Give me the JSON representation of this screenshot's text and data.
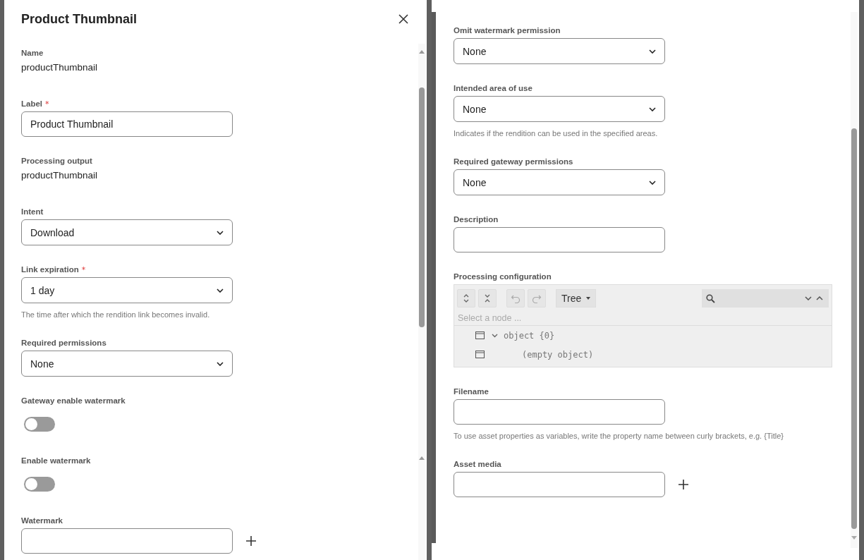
{
  "left_panel": {
    "title": "Product Thumbnail",
    "fields": [
      {
        "kind": "readonly",
        "label": "Name",
        "value": "productThumbnail"
      },
      {
        "kind": "text",
        "label": "Label",
        "required_mark": "*",
        "value": "Product Thumbnail"
      },
      {
        "kind": "readonly",
        "label": "Processing output",
        "value": "productThumbnail"
      },
      {
        "kind": "select",
        "label": "Intent",
        "value": "Download"
      },
      {
        "kind": "select",
        "label": "Link expiration",
        "required_mark": "*",
        "value": "1 day",
        "help": "The time after which the rendition link becomes invalid."
      },
      {
        "kind": "select",
        "label": "Required permissions",
        "value": "None"
      },
      {
        "kind": "toggle",
        "label": "Gateway enable watermark",
        "on": false
      },
      {
        "kind": "toggle",
        "label": "Enable watermark",
        "on": false
      },
      {
        "kind": "lookup",
        "label": "Watermark"
      }
    ]
  },
  "right_panel": {
    "fields": [
      {
        "kind": "select",
        "label": "Omit watermark permission",
        "value": "None"
      },
      {
        "kind": "select",
        "label": "Intended area of use",
        "value": "None",
        "help": "Indicates if the rendition can be used in the specified areas."
      },
      {
        "kind": "select",
        "label": "Required gateway permissions",
        "value": "None"
      },
      {
        "kind": "text",
        "label": "Description"
      },
      {
        "kind": "json_editor",
        "label": "Processing configuration",
        "editor": {
          "mode": "Tree",
          "path_placeholder": "Select a node ...",
          "nodes": [
            {
              "text": "object {0}",
              "expanded": true,
              "children": [
                {
                  "text": "(empty object)"
                }
              ]
            }
          ]
        }
      },
      {
        "kind": "text",
        "label": "Filename",
        "help": "To use asset properties as variables, write the property name between curly brackets, e.g. {Title}"
      },
      {
        "kind": "lookup",
        "label": "Asset media"
      }
    ]
  }
}
